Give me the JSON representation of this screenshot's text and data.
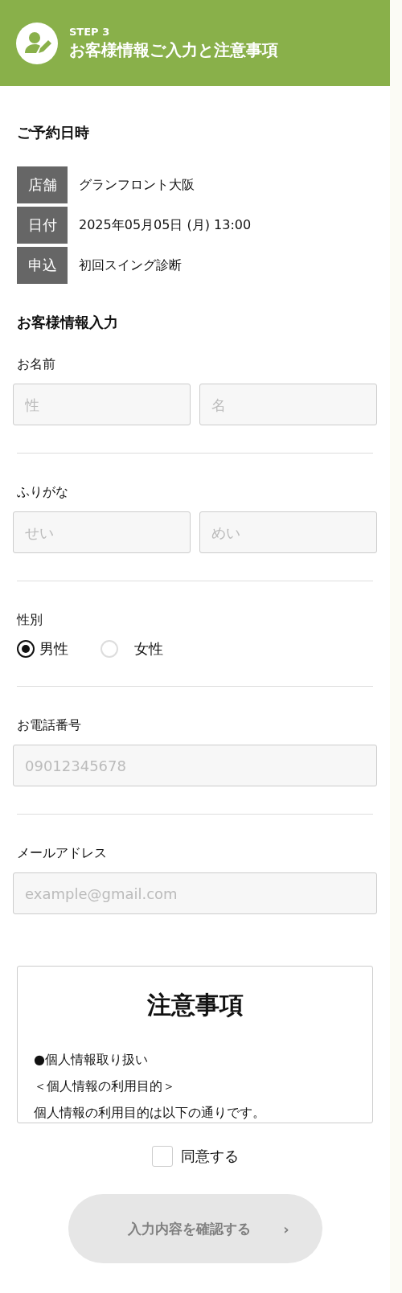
{
  "header": {
    "step": "STEP 3",
    "title": "お客様情報ご入力と注意事項"
  },
  "reservation": {
    "heading": "ご予約日時",
    "rows": [
      {
        "label": "店舗",
        "value": "グランフロント大阪"
      },
      {
        "label": "日付",
        "value": "2025年05月05日 (月) 13:00"
      },
      {
        "label": "申込",
        "value": "初回スイング診断"
      }
    ]
  },
  "customer": {
    "heading": "お客様情報入力",
    "fields": [
      {
        "kind": "pair",
        "label": "お名前",
        "inputs": [
          {
            "placeholder": "性"
          },
          {
            "placeholder": "名"
          }
        ]
      },
      {
        "kind": "pair",
        "label": "ふりがな",
        "inputs": [
          {
            "placeholder": "せい"
          },
          {
            "placeholder": "めい"
          }
        ]
      },
      {
        "kind": "radio",
        "label": "性別",
        "options": [
          {
            "label": "男性",
            "selected": true
          },
          {
            "label": "女性",
            "selected": false
          }
        ]
      },
      {
        "kind": "single",
        "label": "お電話番号",
        "inputs": [
          {
            "placeholder": "09012345678"
          }
        ]
      },
      {
        "kind": "single",
        "label": "メールアドレス",
        "inputs": [
          {
            "placeholder": "example@gmail.com"
          }
        ]
      }
    ]
  },
  "notice": {
    "title": "注意事項",
    "lines": [
      "●個人情報取り扱い",
      "＜個人情報の利用目的＞",
      "個人情報の利用目的は以下の通りです。"
    ]
  },
  "agree": {
    "label": "同意する",
    "checked": false
  },
  "submit": {
    "label": "入力内容を確認する",
    "arrow": "›",
    "disabled": true
  }
}
